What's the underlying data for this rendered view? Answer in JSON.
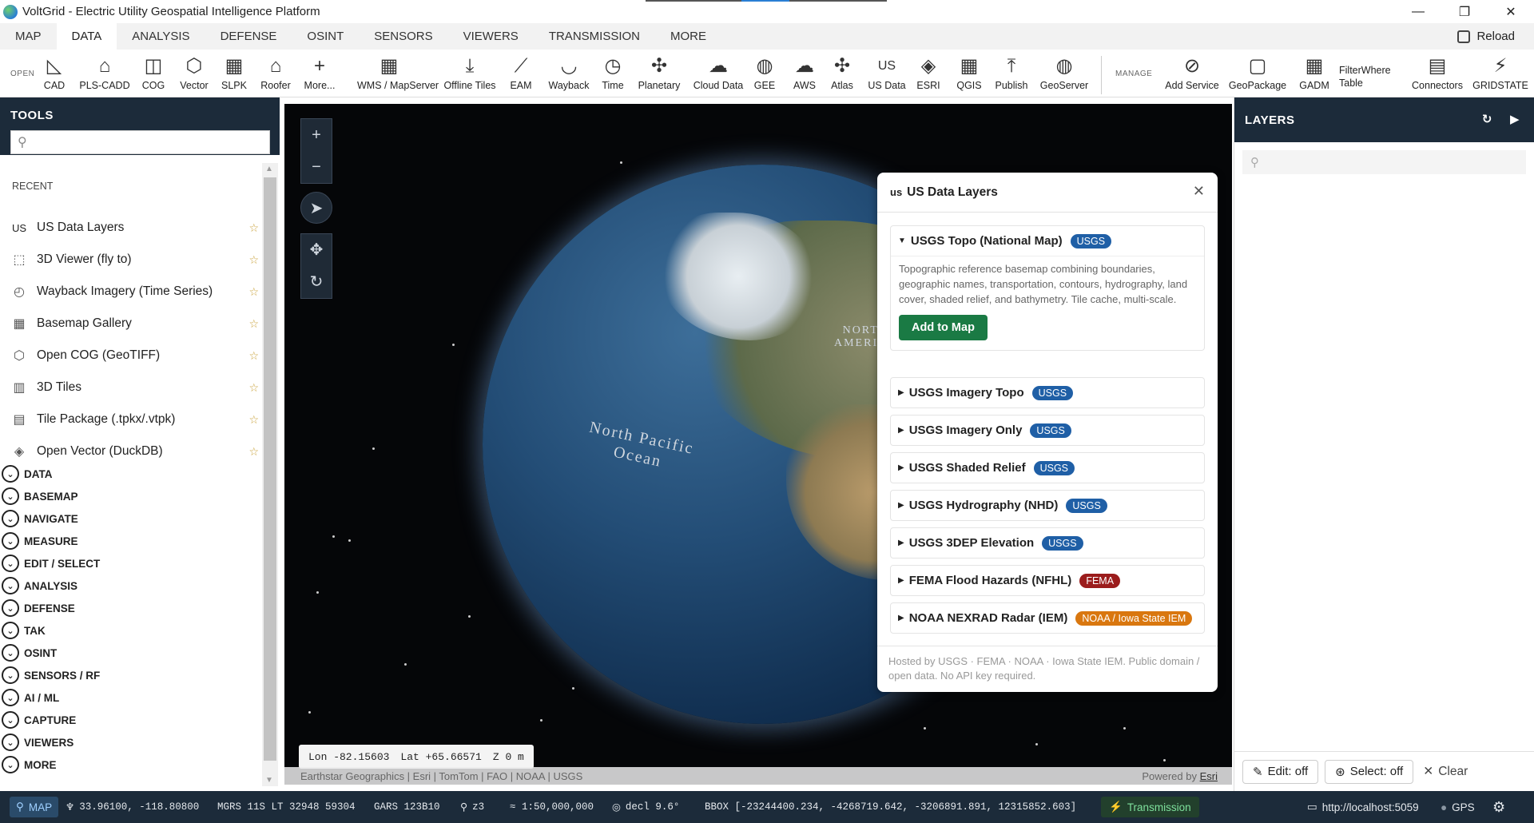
{
  "window": {
    "title": "VoltGrid - Electric Utility Geospatial Intelligence Platform"
  },
  "menu": {
    "tabs": [
      "MAP",
      "DATA",
      "ANALYSIS",
      "DEFENSE",
      "OSINT",
      "SENSORS",
      "VIEWERS",
      "TRANSMISSION",
      "MORE"
    ],
    "active": "DATA",
    "reload_label": "Reload"
  },
  "toolbar": {
    "open_label": "OPEN",
    "manage_label": "MANAGE",
    "items": [
      {
        "label": "CAD",
        "icon": "cad-icon"
      },
      {
        "label": "PLS-CADD",
        "icon": "tower-icon"
      },
      {
        "label": "COG",
        "icon": "cube-icon"
      },
      {
        "label": "Vector",
        "icon": "vector-icon"
      },
      {
        "label": "SLPK",
        "icon": "building-icon"
      },
      {
        "label": "Roofer",
        "icon": "house-icon"
      },
      {
        "label": "More...",
        "icon": "plus-icon"
      },
      {
        "label": "WMS / MapServer",
        "icon": "map-icon"
      },
      {
        "label": "Offline Tiles",
        "icon": "download-icon"
      },
      {
        "label": "EAM",
        "icon": "wrench-icon"
      },
      {
        "label": "Wayback",
        "icon": "camera-icon"
      },
      {
        "label": "Time",
        "icon": "clock-icon"
      },
      {
        "label": "Planetary",
        "icon": "satellite-icon"
      },
      {
        "label": "Cloud Data",
        "icon": "cloud-icon"
      },
      {
        "label": "GEE",
        "icon": "globe-icon"
      },
      {
        "label": "AWS",
        "icon": "cloud-icon"
      },
      {
        "label": "Atlas",
        "icon": "satellite-icon"
      },
      {
        "label": "US Data",
        "icon": "us-icon"
      },
      {
        "label": "ESRI",
        "icon": "layers-icon"
      },
      {
        "label": "QGIS",
        "icon": "map-icon"
      },
      {
        "label": "Publish",
        "icon": "upload-icon"
      },
      {
        "label": "GeoServer",
        "icon": "globe-icon"
      },
      {
        "label": "Add Service",
        "icon": "link-icon"
      },
      {
        "label": "GeoPackage",
        "icon": "package-icon"
      },
      {
        "label": "GADM",
        "icon": "map-icon"
      },
      {
        "label": "FilterWhere Table",
        "icon": ""
      },
      {
        "label": "Connectors",
        "icon": "document-icon"
      },
      {
        "label": "GRIDSTATE",
        "icon": "bolt-icon"
      }
    ]
  },
  "tools": {
    "title": "TOOLS",
    "search_placeholder": "",
    "recent_label": "RECENT",
    "recent": [
      {
        "icon_text": "US",
        "label": "US Data Layers"
      },
      {
        "icon_text": "⬚",
        "label": "3D Viewer (fly to)"
      },
      {
        "icon_text": "◴",
        "label": "Wayback Imagery (Time Series)"
      },
      {
        "icon_text": "▦",
        "label": "Basemap Gallery"
      },
      {
        "icon_text": "⬡",
        "label": "Open COG (GeoTIFF)"
      },
      {
        "icon_text": "▥",
        "label": "3D Tiles"
      },
      {
        "icon_text": "▤",
        "label": "Tile Package (.tpkx/.vtpk)"
      },
      {
        "icon_text": "◈",
        "label": "Open Vector (DuckDB)"
      }
    ],
    "categories": [
      "DATA",
      "BASEMAP",
      "NAVIGATE",
      "MEASURE",
      "EDIT / SELECT",
      "ANALYSIS",
      "DEFENSE",
      "TAK",
      "OSINT",
      "SENSORS / RF",
      "AI / ML",
      "CAPTURE",
      "VIEWERS",
      "MORE"
    ]
  },
  "map": {
    "labels": {
      "continent": "NORTH\nAMERICA",
      "ocean": "North Pacific\nOcean"
    },
    "coords": {
      "lon": "Lon -82.15603",
      "lat": "Lat +65.66571",
      "z": "Z 0 m"
    },
    "attribution": "Earthstar Geographics | Esri | TomTom | FAO | NOAA | USGS",
    "powered_prefix": "Powered by",
    "powered_link": "Esri"
  },
  "popup": {
    "prefix": "us",
    "title": "US Data Layers",
    "layers": [
      {
        "name": "USGS Topo (National Map)",
        "badge": "USGS",
        "badge_color": "#1f5fa6",
        "expanded": true,
        "description": "Topographic reference basemap combining boundaries, geographic names, transportation, contours, hydrography, land cover, shaded relief, and bathymetry. Tile cache, multi-scale.",
        "action": "Add to Map"
      },
      {
        "name": "USGS Imagery Topo",
        "badge": "USGS",
        "badge_color": "#1f5fa6"
      },
      {
        "name": "USGS Imagery Only",
        "badge": "USGS",
        "badge_color": "#1f5fa6"
      },
      {
        "name": "USGS Shaded Relief",
        "badge": "USGS",
        "badge_color": "#1f5fa6"
      },
      {
        "name": "USGS Hydrography (NHD)",
        "badge": "USGS",
        "badge_color": "#1f5fa6"
      },
      {
        "name": "USGS 3DEP Elevation",
        "badge": "USGS",
        "badge_color": "#1f5fa6"
      },
      {
        "name": "FEMA Flood Hazards (NFHL)",
        "badge": "FEMA",
        "badge_color": "#9b1c1c"
      },
      {
        "name": "NOAA NEXRAD Radar (IEM)",
        "badge": "NOAA / Iowa State IEM",
        "badge_color": "#d9770f"
      }
    ],
    "footer": "Hosted by USGS · FEMA · NOAA · Iowa State IEM. Public domain / open data. No API key required."
  },
  "layers_panel": {
    "title": "LAYERS",
    "search_placeholder": "",
    "edit_label": "Edit: off",
    "select_label": "Select: off",
    "clear_label": "Clear"
  },
  "status": {
    "mode": "MAP",
    "latlon": "33.96100, -118.80800",
    "mgrs": "MGRS 11S LT 32948 59304",
    "gars": "GARS 123B10",
    "zoom": "z3",
    "scale": "≈ 1:50,000,000",
    "decl": "decl 9.6°",
    "bbox": "BBOX [-23244400.234, -4268719.642, -3206891.891, 12315852.603]",
    "transmission": "Transmission",
    "server": "http://localhost:5059",
    "gps": "GPS"
  },
  "colors": {
    "panel_dark": "#1c2b3a",
    "accent_green": "#1a7a44",
    "usgs_blue": "#1f5fa6",
    "fema_red": "#9b1c1c",
    "noaa_orange": "#d9770f"
  }
}
